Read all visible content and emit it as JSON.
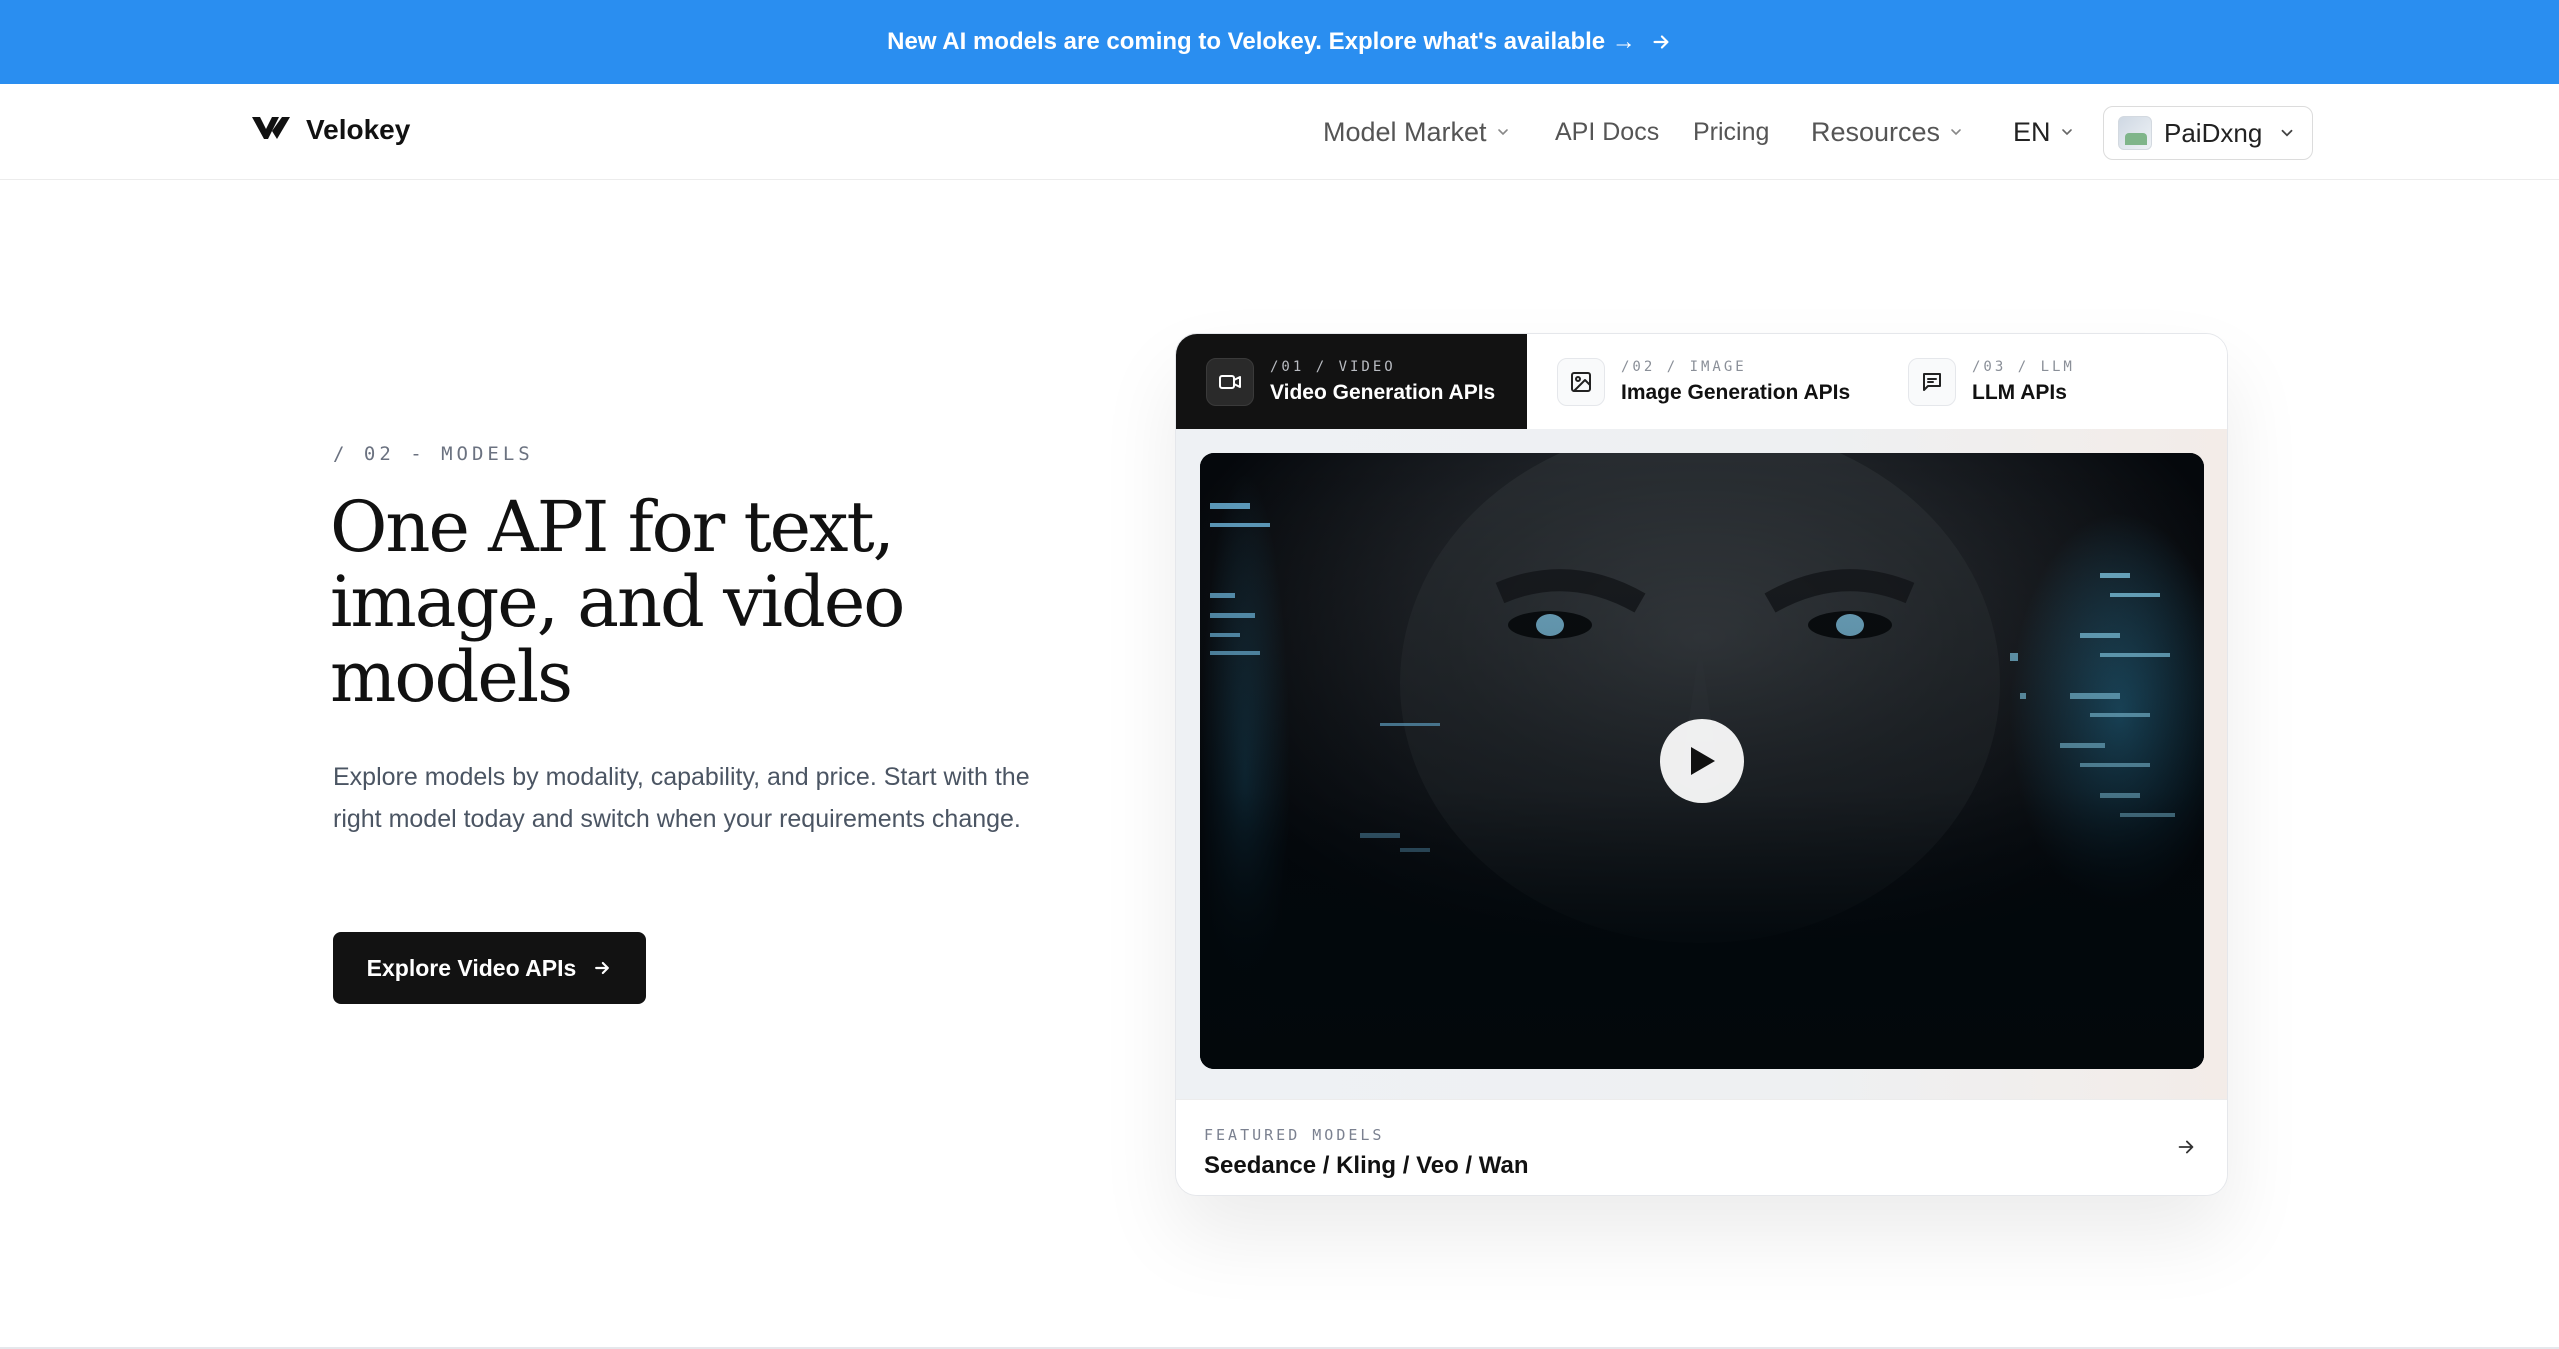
{
  "banner": {
    "text": "New AI models are coming to Velokey. Explore what's available →"
  },
  "header": {
    "brand": "Velokey",
    "nav": {
      "model_market": "Model Market",
      "api_docs": "API Docs",
      "pricing": "Pricing",
      "resources": "Resources",
      "language": "EN"
    },
    "user": {
      "name": "PaiDxng"
    }
  },
  "hero": {
    "eyebrow": "/ 02 - MODELS",
    "title_lines": [
      "One API for text,",
      "image, and video",
      "models"
    ],
    "description": "Explore models by modality, capability, and price. Start with the right model today and switch when your requirements change.",
    "cta_label": "Explore Video APIs"
  },
  "showcase": {
    "tabs": [
      {
        "kicker": "/01 / VIDEO",
        "label": "Video Generation APIs",
        "icon": "video-camera-icon",
        "active": true
      },
      {
        "kicker": "/02 / IMAGE",
        "label": "Image Generation APIs",
        "icon": "image-icon",
        "active": false
      },
      {
        "kicker": "/03 / LLM",
        "label": "LLM APIs",
        "icon": "chat-icon",
        "active": false
      }
    ],
    "featured": {
      "kicker": "FEATURED MODELS",
      "models": "Seedance / Kling / Veo / Wan"
    }
  },
  "colors": {
    "banner": "#2a8ef0",
    "dark": "#121212",
    "accent_glow": "#2bb6ff"
  }
}
